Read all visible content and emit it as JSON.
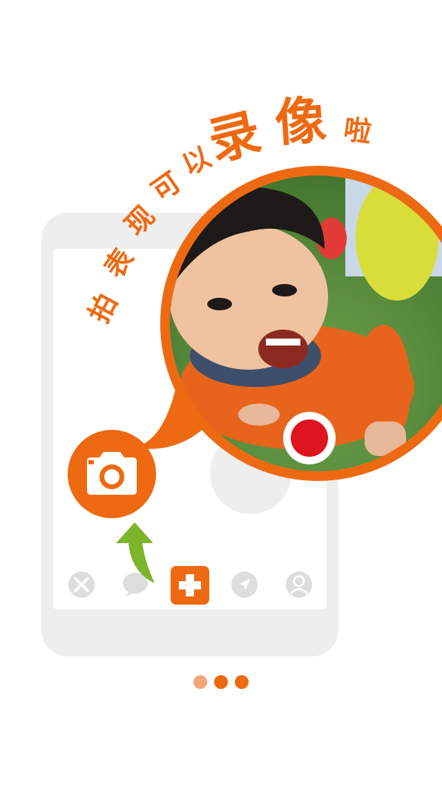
{
  "headline": {
    "small_chars": [
      "拍",
      "表",
      "现",
      "可",
      "以"
    ],
    "big_chars": [
      "录",
      "像"
    ],
    "tail_char": "啦"
  },
  "photo": {
    "subject": "child-photo"
  },
  "colors": {
    "accent": "#ee6a12",
    "accent_light": "#f4a878",
    "record_red": "#e0141f",
    "arrow_green": "#7db52a",
    "phone_gray": "#eeeeee",
    "tab_gray": "#dddddd"
  },
  "tab_bar": {
    "items": [
      {
        "icon": "compass-icon"
      },
      {
        "icon": "chat-icon"
      },
      {
        "icon": "plus-icon"
      },
      {
        "icon": "location-arrow-icon"
      },
      {
        "icon": "profile-icon"
      }
    ]
  },
  "pager": {
    "count": 3,
    "active_index": 0
  }
}
